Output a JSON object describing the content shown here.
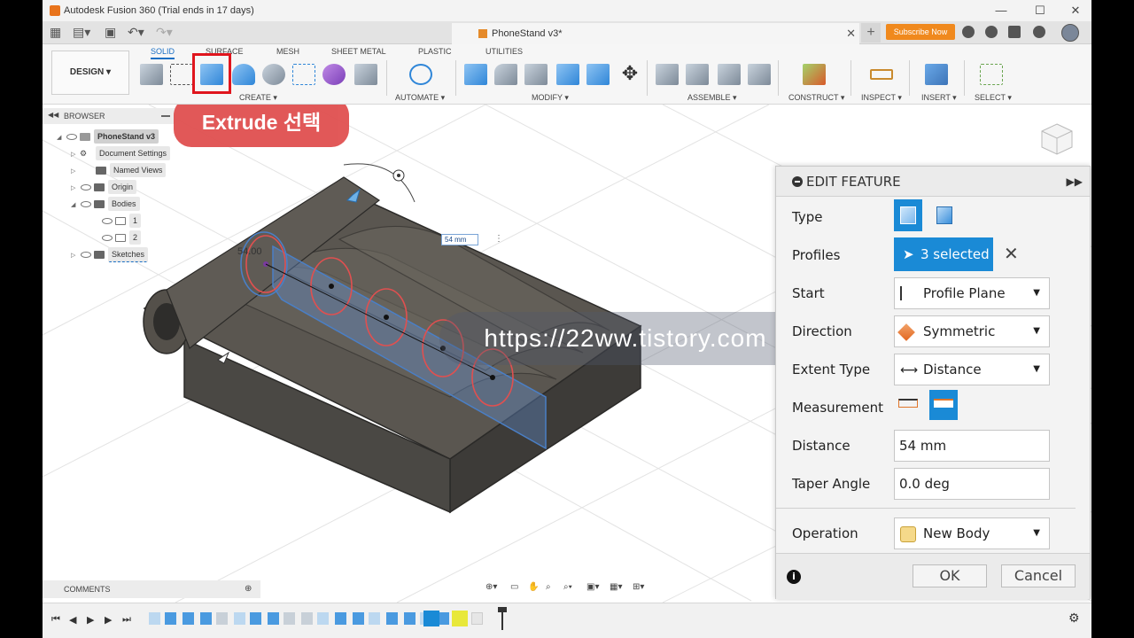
{
  "window": {
    "title": "Autodesk Fusion 360 (Trial ends in 17 days)"
  },
  "tabbar": {
    "document_tab": "PhoneStand v3*",
    "subscribe": "Subscribe Now"
  },
  "ribbon": {
    "workspace": "DESIGN ▾",
    "tabs": [
      "SOLID",
      "SURFACE",
      "MESH",
      "SHEET METAL",
      "PLASTIC",
      "UTILITIES"
    ],
    "groups": [
      "CREATE ▾",
      "AUTOMATE ▾",
      "MODIFY ▾",
      "ASSEMBLE ▾",
      "CONSTRUCT ▾",
      "INSPECT ▾",
      "INSERT ▾",
      "SELECT ▾"
    ]
  },
  "browser": {
    "header": "BROWSER",
    "items": [
      {
        "label": "PhoneStand v3"
      },
      {
        "label": "Document Settings"
      },
      {
        "label": "Named Views"
      },
      {
        "label": "Origin"
      },
      {
        "label": "Bodies"
      },
      {
        "label": "1"
      },
      {
        "label": "2"
      },
      {
        "label": "Sketches"
      }
    ]
  },
  "annotation": "Extrude 선택",
  "watermark": "https://22ww.tistory.com",
  "viewport": {
    "dim_input": "54 mm",
    "dim_label": "54.00"
  },
  "panel": {
    "title": "EDIT FEATURE",
    "type_label": "Type",
    "profiles_label": "Profiles",
    "profiles_value": "3 selected",
    "start_label": "Start",
    "start_value": "Profile Plane",
    "direction_label": "Direction",
    "direction_value": "Symmetric",
    "extent_label": "Extent Type",
    "extent_value": "Distance",
    "measurement_label": "Measurement",
    "distance_label": "Distance",
    "distance_value": "54 mm",
    "taper_label": "Taper Angle",
    "taper_value": "0.0 deg",
    "operation_label": "Operation",
    "operation_value": "New Body",
    "ok": "OK",
    "cancel": "Cancel"
  },
  "comments": "COMMENTS",
  "colors": {
    "accent": "#1a8ad6",
    "highlight": "#e0151d",
    "annotation_bg": "#e05050",
    "subscribe": "#f0891d"
  }
}
